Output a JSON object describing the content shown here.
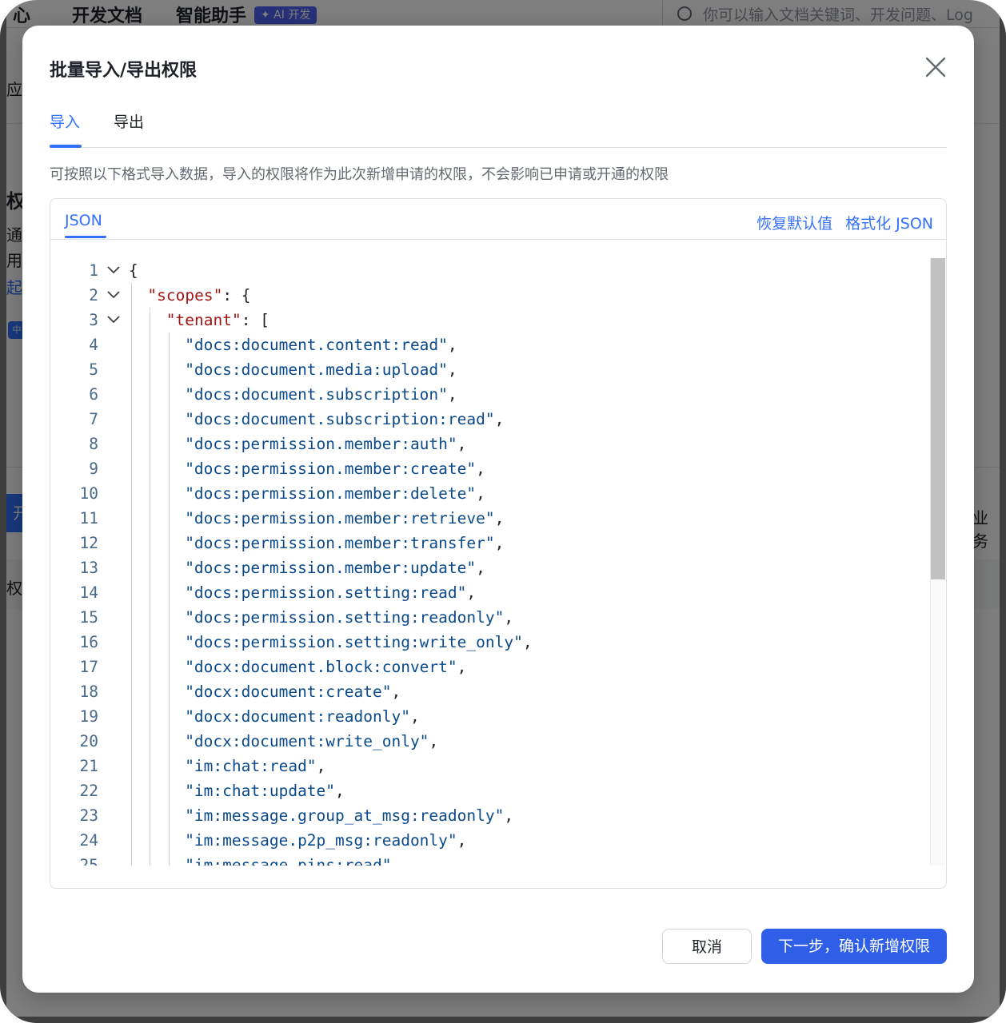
{
  "background": {
    "nav": [
      "心",
      "开发文档",
      "智能助手"
    ],
    "ai_badge": "✦ AI 开发",
    "search_placeholder": "你可以输入文档关键词、开发问题、Log",
    "fragments": [
      "应月",
      "权限",
      "通",
      "用",
      "起",
      "中",
      "开通",
      "业务",
      "权限"
    ]
  },
  "modal": {
    "title": "批量导入/导出权限",
    "tabs": [
      {
        "label": "导入",
        "active": true
      },
      {
        "label": "导出",
        "active": false
      }
    ],
    "description": "可按照以下格式导入数据，导入的权限将作为此次新增申请的权限，不会影响已申请或开通的权限",
    "editor": {
      "language_tab": "JSON",
      "actions": {
        "restore": "恢复默认值",
        "format": "格式化 JSON"
      },
      "lines": [
        {
          "n": "1",
          "text": "{"
        },
        {
          "n": "2",
          "key": "\"scopes\"",
          "text": ": {"
        },
        {
          "n": "3",
          "key": "\"tenant\"",
          "text": ": ["
        },
        {
          "n": "4",
          "str": "\"docs:document.content:read\"",
          "text": ","
        },
        {
          "n": "5",
          "str": "\"docs:document.media:upload\"",
          "text": ","
        },
        {
          "n": "6",
          "str": "\"docs:document.subscription\"",
          "text": ","
        },
        {
          "n": "7",
          "str": "\"docs:document.subscription:read\"",
          "text": ","
        },
        {
          "n": "8",
          "str": "\"docs:permission.member:auth\"",
          "text": ","
        },
        {
          "n": "9",
          "str": "\"docs:permission.member:create\"",
          "text": ","
        },
        {
          "n": "10",
          "str": "\"docs:permission.member:delete\"",
          "text": ","
        },
        {
          "n": "11",
          "str": "\"docs:permission.member:retrieve\"",
          "text": ","
        },
        {
          "n": "12",
          "str": "\"docs:permission.member:transfer\"",
          "text": ","
        },
        {
          "n": "13",
          "str": "\"docs:permission.member:update\"",
          "text": ","
        },
        {
          "n": "14",
          "str": "\"docs:permission.setting:read\"",
          "text": ","
        },
        {
          "n": "15",
          "str": "\"docs:permission.setting:readonly\"",
          "text": ","
        },
        {
          "n": "16",
          "str": "\"docs:permission.setting:write_only\"",
          "text": ","
        },
        {
          "n": "17",
          "str": "\"docx:document.block:convert\"",
          "text": ","
        },
        {
          "n": "18",
          "str": "\"docx:document:create\"",
          "text": ","
        },
        {
          "n": "19",
          "str": "\"docx:document:readonly\"",
          "text": ","
        },
        {
          "n": "20",
          "str": "\"docx:document:write_only\"",
          "text": ","
        },
        {
          "n": "21",
          "str": "\"im:chat:read\"",
          "text": ","
        },
        {
          "n": "22",
          "str": "\"im:chat:update\"",
          "text": ","
        },
        {
          "n": "23",
          "str": "\"im:message.group_at_msg:readonly\"",
          "text": ","
        },
        {
          "n": "24",
          "str": "\"im:message.p2p_msg:readonly\"",
          "text": ","
        },
        {
          "n": "25",
          "str": "\"im:message.pins:read\"",
          "text": ","
        }
      ]
    },
    "buttons": {
      "cancel": "取消",
      "next": "下一步，确认新增权限"
    }
  }
}
